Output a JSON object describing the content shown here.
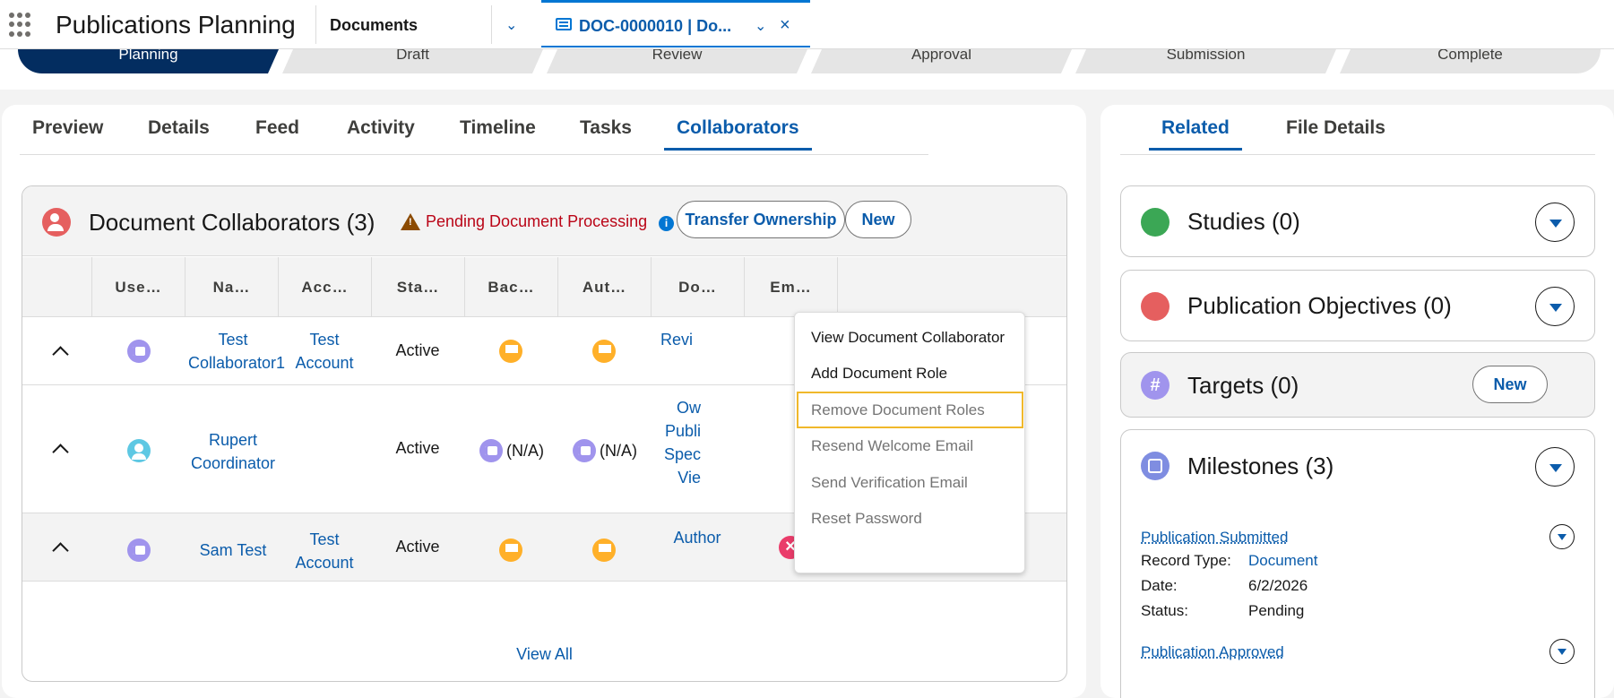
{
  "header": {
    "app_name": "Publications Planning",
    "nav_tab": "Documents",
    "doc_tab": "DOC-0000010 | Do..."
  },
  "path": {
    "steps": [
      "Planning",
      "Draft",
      "Review",
      "Approval",
      "Submission",
      "Complete"
    ],
    "current": "Planning"
  },
  "left_tabs": [
    "Preview",
    "Details",
    "Feed",
    "Activity",
    "Timeline",
    "Tasks",
    "Collaborators"
  ],
  "left_active_tab": "Collaborators",
  "collaborators": {
    "title": "Document Collaborators (3)",
    "warning": "Pending Document Processing",
    "transfer_label": "Transfer Ownership",
    "new_label": "New",
    "columns": [
      "Use…",
      "Na…",
      "Acc…",
      "Sta…",
      "Bac…",
      "Aut…",
      "Do…",
      "Em…"
    ],
    "rows": [
      {
        "name": "Test Collaborator1",
        "account": "Test Account",
        "status": "Active",
        "role": "Revi"
      },
      {
        "name": "Rupert Coordinator",
        "account": "",
        "status": "Active",
        "bac": "(N/A)",
        "aut": "(N/A)",
        "role": "Ow Publi Spec Vie"
      },
      {
        "name": "Sam Test",
        "account": "Test Account",
        "status": "Active",
        "role": "Author"
      }
    ],
    "view_all": "View All"
  },
  "row_menu": {
    "items": [
      "View Document Collaborator",
      "Add Document Role",
      "Remove Document Roles",
      "Resend Welcome Email",
      "Send Verification Email",
      "Reset Password"
    ]
  },
  "right_tabs": [
    "Related",
    "File Details"
  ],
  "right_active_tab": "Related",
  "related": {
    "studies": "Studies (0)",
    "objectives": "Publication Objectives (0)",
    "targets": "Targets (0)",
    "targets_new": "New",
    "milestones": "Milestones (3)",
    "milestone_items": [
      {
        "title": "Publication Submitted",
        "record_type_label": "Record Type:",
        "record_type": "Document",
        "date_label": "Date:",
        "date": "6/2/2026",
        "status_label": "Status:",
        "status": "Pending"
      },
      {
        "title": "Publication Approved"
      }
    ]
  },
  "colors": {
    "brand": "#0b5cab",
    "path_active": "#032d60",
    "warning_text": "#ba0517",
    "focus_outline": "#f0b82b"
  }
}
